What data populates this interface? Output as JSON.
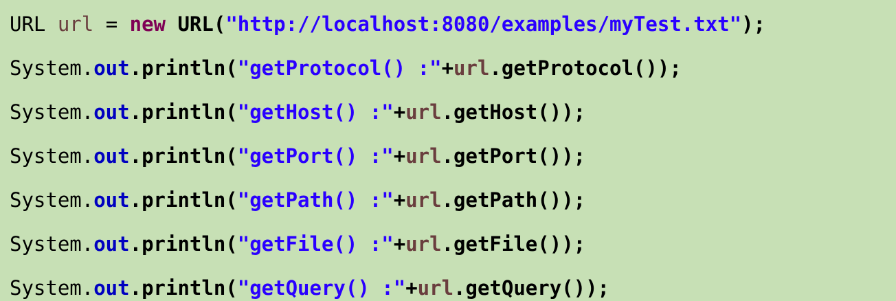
{
  "code": {
    "lines": [
      [
        {
          "text": "URL ",
          "kind": "plain"
        },
        {
          "text": "url",
          "kind": "var"
        },
        {
          "text": " = ",
          "kind": "plain"
        },
        {
          "text": "new",
          "kind": "keyword"
        },
        {
          "text": " URL(",
          "kind": "bold"
        },
        {
          "text": "\"http://localhost:8080/examples/myTest.txt\"",
          "kind": "string"
        },
        {
          "text": ");",
          "kind": "bold"
        }
      ],
      [
        {
          "text": "System.",
          "kind": "plain"
        },
        {
          "text": "out",
          "kind": "field"
        },
        {
          "text": ".println(",
          "kind": "bold"
        },
        {
          "text": "\"getProtocol() :\"",
          "kind": "string"
        },
        {
          "text": "+",
          "kind": "bold"
        },
        {
          "text": "url",
          "kind": "var-bold"
        },
        {
          "text": ".getProtocol());",
          "kind": "bold"
        }
      ],
      [
        {
          "text": "System.",
          "kind": "plain"
        },
        {
          "text": "out",
          "kind": "field"
        },
        {
          "text": ".println(",
          "kind": "bold"
        },
        {
          "text": "\"getHost() :\"",
          "kind": "string"
        },
        {
          "text": "+",
          "kind": "bold"
        },
        {
          "text": "url",
          "kind": "var-bold"
        },
        {
          "text": ".getHost());",
          "kind": "bold"
        }
      ],
      [
        {
          "text": "System.",
          "kind": "plain"
        },
        {
          "text": "out",
          "kind": "field"
        },
        {
          "text": ".println(",
          "kind": "bold"
        },
        {
          "text": "\"getPort() :\"",
          "kind": "string"
        },
        {
          "text": "+",
          "kind": "bold"
        },
        {
          "text": "url",
          "kind": "var-bold"
        },
        {
          "text": ".getPort());",
          "kind": "bold"
        }
      ],
      [
        {
          "text": "System.",
          "kind": "plain"
        },
        {
          "text": "out",
          "kind": "field"
        },
        {
          "text": ".println(",
          "kind": "bold"
        },
        {
          "text": "\"getPath() :\"",
          "kind": "string"
        },
        {
          "text": "+",
          "kind": "bold"
        },
        {
          "text": "url",
          "kind": "var-bold"
        },
        {
          "text": ".getPath());",
          "kind": "bold"
        }
      ],
      [
        {
          "text": "System.",
          "kind": "plain"
        },
        {
          "text": "out",
          "kind": "field"
        },
        {
          "text": ".println(",
          "kind": "bold"
        },
        {
          "text": "\"getFile() :\"",
          "kind": "string"
        },
        {
          "text": "+",
          "kind": "bold"
        },
        {
          "text": "url",
          "kind": "var-bold"
        },
        {
          "text": ".getFile());",
          "kind": "bold"
        }
      ],
      [
        {
          "text": "System.",
          "kind": "plain"
        },
        {
          "text": "out",
          "kind": "field"
        },
        {
          "text": ".println(",
          "kind": "bold"
        },
        {
          "text": "\"getQuery() :\"",
          "kind": "string"
        },
        {
          "text": "+",
          "kind": "bold"
        },
        {
          "text": "url",
          "kind": "var-bold"
        },
        {
          "text": ".getQuery());",
          "kind": "bold"
        }
      ]
    ]
  }
}
